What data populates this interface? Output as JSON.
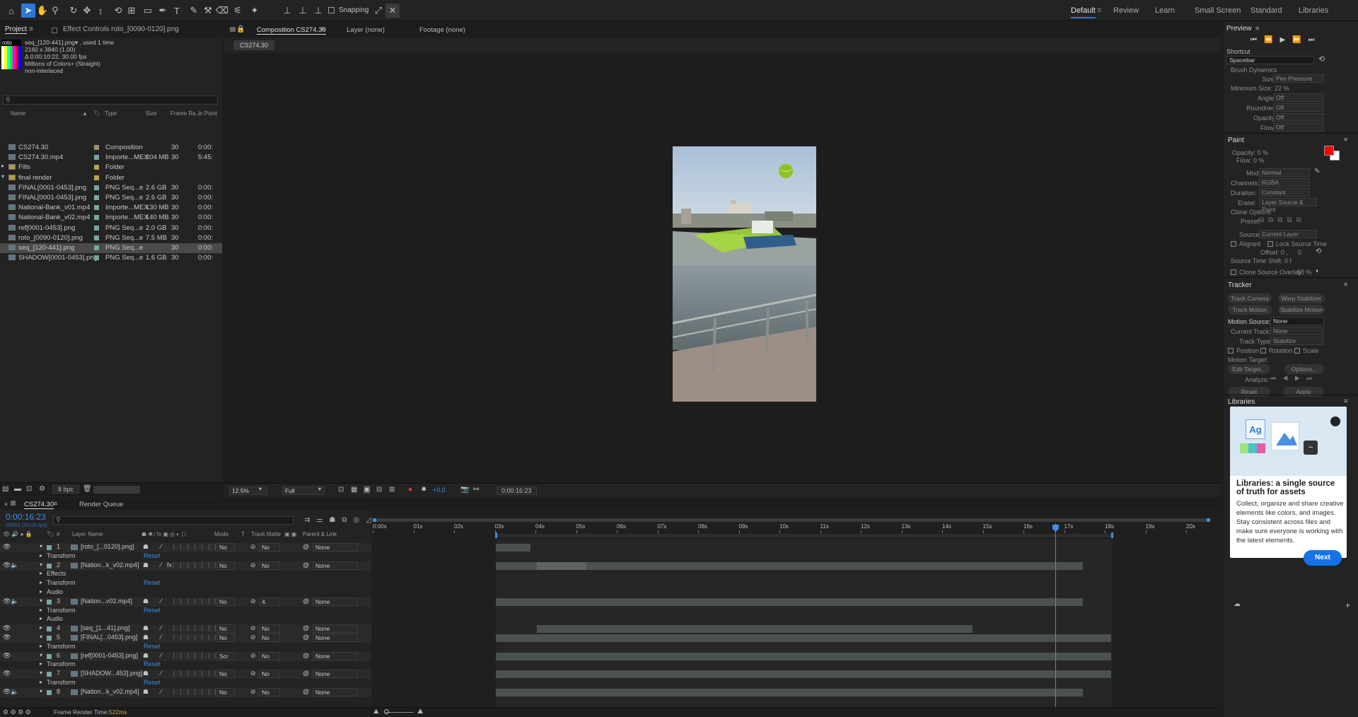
{
  "toolbar": {
    "snapping_label": "Snapping",
    "workspaces": [
      "Default",
      "Review",
      "Learn",
      "Small Screen",
      "Standard",
      "Libraries"
    ]
  },
  "project": {
    "tab_label": "Project",
    "effect_tab_label": "Effect Controls roto_[0090-0120].png",
    "thumb_label": "roto",
    "info": [
      "seq_[120-441].png▾ , used 1 time",
      "2160 x 3840 (1.00)",
      "Δ 0:00:10:22, 30.00 fps",
      "Millions of Colors+ (Straight)",
      "non-interlaced"
    ],
    "columns": [
      "Name",
      "Type",
      "Size",
      "Frame Ra...",
      "In Point"
    ],
    "items": [
      {
        "name": "CS274.30",
        "type": "Composition",
        "size": "",
        "fps": "30",
        "in": "0:00:",
        "color": "#9a8f6e"
      },
      {
        "name": "CS274.30.mp4",
        "type": "Importe...MEX",
        "size": "204 MB",
        "fps": "30",
        "in": "5:45:",
        "color": "#7aa5a5"
      },
      {
        "name": "Fills",
        "type": "Folder",
        "size": "",
        "fps": "",
        "in": "",
        "color": "#b7a34a"
      },
      {
        "name": "final render",
        "type": "Folder",
        "size": "",
        "fps": "",
        "in": "",
        "color": "#b7a34a"
      },
      {
        "name": "FINAL[0001-0453].png",
        "type": "PNG Seq...e",
        "size": "2.6 GB",
        "fps": "30",
        "in": "0:00:",
        "color": "#7aa5a5"
      },
      {
        "name": "FINAL[0001-0453].png",
        "type": "PNG Seq...e",
        "size": "2.6 GB",
        "fps": "30",
        "in": "0:00:",
        "color": "#7aa5a5"
      },
      {
        "name": "National-Bank_v01.mp4",
        "type": "Importe...MEX",
        "size": "130 MB",
        "fps": "30",
        "in": "0:00:",
        "color": "#7aa5a5"
      },
      {
        "name": "National-Bank_v02.mp4",
        "type": "Importe...MEX",
        "size": "140 MB",
        "fps": "30",
        "in": "0:00:",
        "color": "#7aa5a5"
      },
      {
        "name": "ref[0001-0453].png",
        "type": "PNG Seq...e",
        "size": "2.0 GB",
        "fps": "30",
        "in": "0:00:",
        "color": "#7aa5a5"
      },
      {
        "name": "roto_[0090-0120].png",
        "type": "PNG Seq...e",
        "size": "7.5 MB",
        "fps": "30",
        "in": "0:00:",
        "color": "#7aa5a5"
      },
      {
        "name": "seq_[120-441].png",
        "type": "PNG Seq...e",
        "size": "",
        "fps": "30",
        "in": "0:00:",
        "color": "#7aa5a5"
      },
      {
        "name": "SHADOW[0001-0453].png",
        "type": "PNG Seq...e",
        "size": "1.6 GB",
        "fps": "30",
        "in": "0:00:",
        "color": "#7aa5a5"
      }
    ],
    "bpc": "8 bpc"
  },
  "comp": {
    "tab_label": "Composition CS274.30",
    "layer_tab": "Layer (none)",
    "footage_tab": "Footage (none)",
    "breadcrumb": "CS274.30",
    "zoom": "12.5%",
    "resolution": "Full",
    "exposure": "+0.0",
    "timecode": "0:00:16:23"
  },
  "timeline": {
    "tab_label": "CS274.30",
    "render_queue": "Render Queue",
    "timecode": "0:00:16:23",
    "frame_sub": "00503 (30.00 fps)",
    "col_headers": [
      "#",
      "Layer Name",
      "Mode",
      "T",
      "Track Matte",
      "Parent & Link"
    ],
    "ruler": [
      "0:00s",
      "01s",
      "02s",
      "03s",
      "04s",
      "05s",
      "06s",
      "07s",
      "08s",
      "09s",
      "10s",
      "11s",
      "12s",
      "13s",
      "14s",
      "15s",
      "16s",
      "17s",
      "18s",
      "19s",
      "20s"
    ],
    "rows": [
      {
        "kind": "layer",
        "num": "1",
        "name": "[roto_[...0120].png]",
        "mode": "No",
        "matte": "No",
        "parent": "None",
        "fx": false
      },
      {
        "kind": "prop",
        "name": "Transform",
        "reset": "Reset"
      },
      {
        "kind": "layer",
        "num": "2",
        "name": "[Nation...k_v02.mp4]",
        "mode": "No",
        "matte": "No",
        "parent": "None",
        "fx": true
      },
      {
        "kind": "prop",
        "name": "Effects"
      },
      {
        "kind": "prop",
        "name": "Transform",
        "reset": "Reset"
      },
      {
        "kind": "prop",
        "name": "Audio"
      },
      {
        "kind": "layer",
        "num": "3",
        "name": "[Nation...v02.mp4]",
        "mode": "No",
        "matte": "4.",
        "parent": "None",
        "fx": false
      },
      {
        "kind": "prop",
        "name": "Transform",
        "reset": "Reset"
      },
      {
        "kind": "prop",
        "name": "Audio"
      },
      {
        "kind": "layer",
        "num": "4",
        "name": "[seq_[1...41].png]",
        "mode": "No",
        "matte": "No",
        "parent": "None",
        "fx": false
      },
      {
        "kind": "layer",
        "num": "5",
        "name": "[FINAL[...0453].png]",
        "mode": "No",
        "matte": "No",
        "parent": "None",
        "fx": false
      },
      {
        "kind": "prop",
        "name": "Transform",
        "reset": "Reset"
      },
      {
        "kind": "layer",
        "num": "6",
        "name": "[ref[0001-0453].png]",
        "mode": "Scr",
        "matte": "No",
        "parent": "None",
        "fx": false
      },
      {
        "kind": "prop",
        "name": "Transform",
        "reset": "Reset"
      },
      {
        "kind": "layer",
        "num": "7",
        "name": "[SHADOW...453].png]",
        "mode": "No",
        "matte": "No",
        "parent": "None",
        "fx": false
      },
      {
        "kind": "prop",
        "name": "Transform",
        "reset": "Reset"
      },
      {
        "kind": "layer",
        "num": "8",
        "name": "[Nation...k_v02.mp4]",
        "mode": "No",
        "matte": "No",
        "parent": "None",
        "fx": false
      }
    ],
    "frame_render_label": "Frame Render Time:",
    "frame_render_value": "522ms"
  },
  "preview": {
    "title": "Preview",
    "shortcut_label": "Shortcut",
    "shortcut_value": "Spacebar"
  },
  "brush": {
    "title": "Brush Dynamics",
    "size_label": "Size:",
    "size_value": "Pen Pressure",
    "min_label": "Minimum Size:",
    "min_value": "22 %",
    "angle_label": "Angle:",
    "angle_value": "Off",
    "roundness_label": "Roundness:",
    "roundness_value": "Off",
    "opacity_label": "Opacity:",
    "opacity_value": "Off",
    "flow_label": "Flow:",
    "flow_value": "Off"
  },
  "paint": {
    "title": "Paint",
    "opacity": "Opacity: 0 %",
    "flow": "Flow: 0 %",
    "mode_label": "Mode:",
    "mode_value": "Normal",
    "channels_label": "Channels:",
    "channels_value": "RGBA",
    "duration_label": "Duration:",
    "duration_value": "Constant",
    "erase_label": "Erase:",
    "erase_value": "Layer Source & Paint",
    "clone_options": "Clone Options",
    "preset_label": "Preset:",
    "source_label": "Source:",
    "source_value": "Current Layer",
    "aligned": "Aligned",
    "lock_source": "Lock Source Time",
    "offset": "Offset: 0 ,",
    "offset_y": "0",
    "source_time_shift": "Source Time Shift: 0 f",
    "clone_overlay": "Clone Source Overlay:",
    "clone_overlay_value": "50 %",
    "fg_color": "#ff0000"
  },
  "tracker": {
    "title": "Tracker",
    "track_camera": "Track Camera",
    "warp_stabilizer": "Warp Stabilizer",
    "track_motion": "Track Motion",
    "stabilize_motion": "Stabilize Motion",
    "motion_source_label": "Motion Source:",
    "motion_source_value": "None",
    "current_track_label": "Current Track:",
    "current_track_value": "None",
    "track_type_label": "Track Type:",
    "track_type_value": "Stabilize",
    "position": "Position",
    "rotation": "Rotation",
    "scale": "Scale",
    "motion_target": "Motion Target:",
    "edit_target": "Edit Target...",
    "options": "Options...",
    "analyze": "Analyze:",
    "reset": "Reset",
    "apply": "Apply"
  },
  "libraries": {
    "title": "Libraries",
    "heading": "Libraries: a single source of truth for assets",
    "body": "Collect, organize and share creative elements like colors, and images. Stay consistent across files and make sure everyone is working with the latest elements.",
    "next": "Next"
  }
}
